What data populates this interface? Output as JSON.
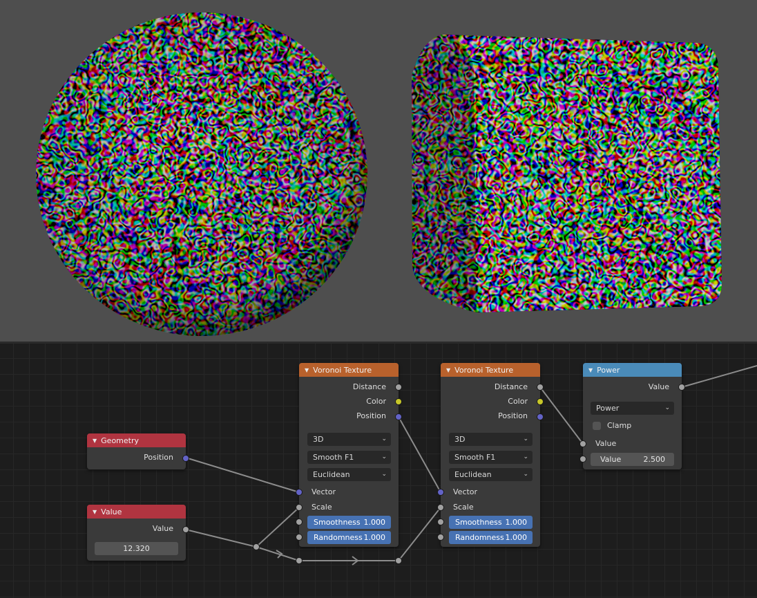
{
  "viewport": {
    "colors": {
      "background": "#4e4e4e",
      "cell_dark": "#0a0a0a",
      "cell_wall": "#e0e0e0"
    },
    "objects": [
      "sphere",
      "cube"
    ]
  },
  "node_editor": {
    "colors": {
      "background": "#1d1d1d",
      "grid": "#272727",
      "link": "#8c8c8c"
    },
    "voronoi1": {
      "title": "Voronoi Texture",
      "outputs": {
        "distance": "Distance",
        "color": "Color",
        "position": "Position"
      },
      "dimensions": "3D",
      "feature": "Smooth F1",
      "metric": "Euclidean",
      "inputs": {
        "vector": "Vector",
        "scale": "Scale"
      },
      "smoothness": {
        "label": "Smoothness",
        "value": "1.000"
      },
      "randomness": {
        "label": "Randomness",
        "value": "1.000"
      }
    },
    "voronoi2": {
      "title": "Voronoi Texture",
      "outputs": {
        "distance": "Distance",
        "color": "Color",
        "position": "Position"
      },
      "dimensions": "3D",
      "feature": "Smooth F1",
      "metric": "Euclidean",
      "inputs": {
        "vector": "Vector",
        "scale": "Scale"
      },
      "smoothness": {
        "label": "Smoothness",
        "value": "1.000"
      },
      "randomness": {
        "label": "Randomness",
        "value": "1.000"
      }
    },
    "power": {
      "title": "Power",
      "output": "Value",
      "operation": "Power",
      "clamp_label": "Clamp",
      "input_label": "Value",
      "value_field": {
        "label": "Value",
        "value": "2.500"
      }
    },
    "geometry": {
      "title": "Geometry",
      "output": "Position"
    },
    "value": {
      "title": "Value",
      "output": "Value",
      "value": "12.320"
    }
  }
}
